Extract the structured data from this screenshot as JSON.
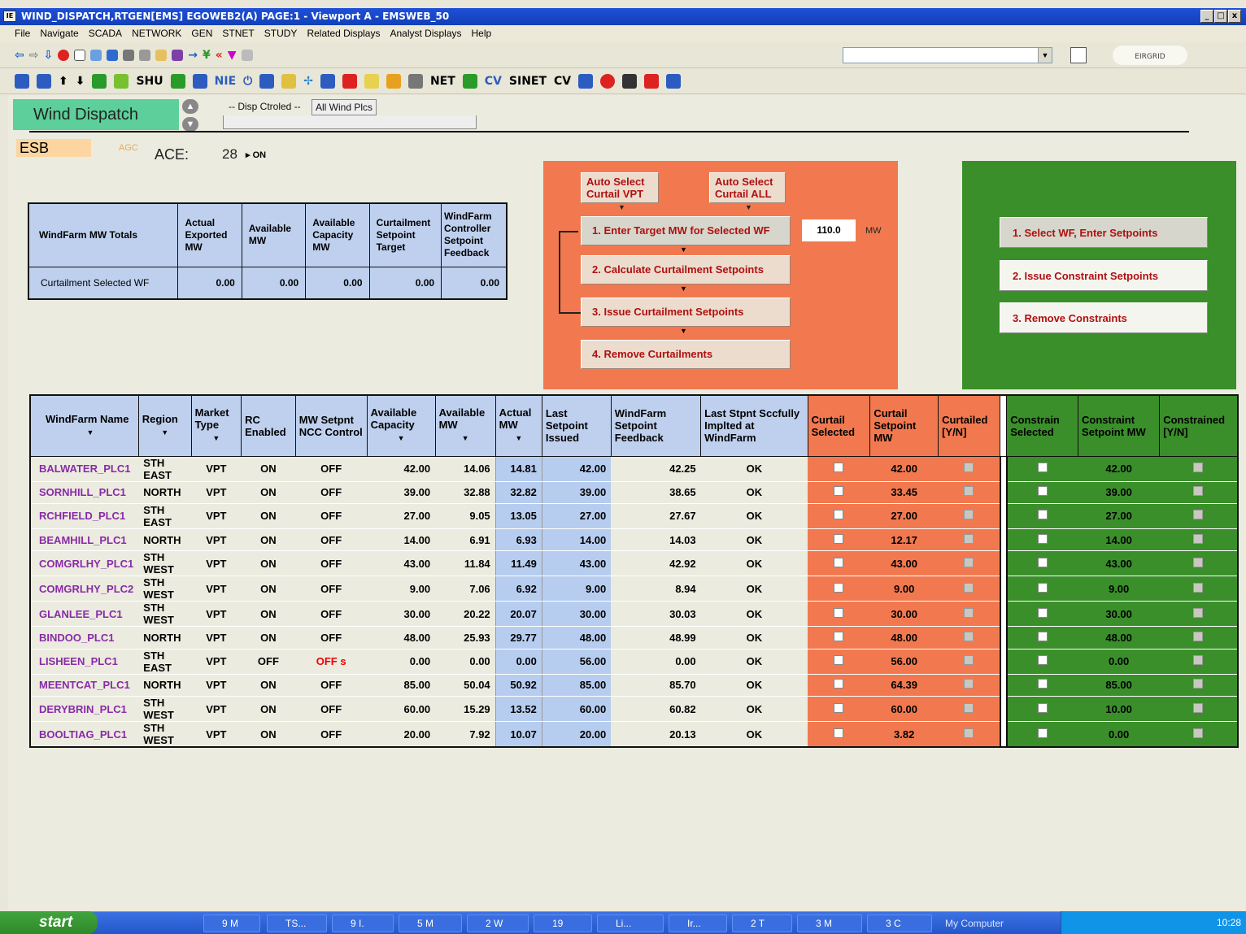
{
  "window": {
    "title": "WIND_DISPATCH,RTGEN[EMS] EGOWEB2(A) PAGE:1  - Viewport A - EMSWEB_50",
    "controls": [
      "_",
      "□",
      "x"
    ]
  },
  "menu": [
    "File",
    "Navigate",
    "SCADA",
    "NETWORK",
    "GEN",
    "STNET",
    "STUDY",
    "Related Displays",
    "Analyst Displays",
    "Help"
  ],
  "toolbar": {
    "labels": [
      "SHU",
      "NIE",
      "NET",
      "CV",
      "SINET",
      "CV"
    ],
    "address": "",
    "logo": "EIRGRID"
  },
  "header": {
    "display_title": "Wind Dispatch",
    "tab_disp": "-- Disp Ctroled --",
    "tab_all": "All Wind Plcs",
    "company": "ESB",
    "agc": "AGC",
    "ace_label": "ACE:",
    "ace_value": "28",
    "ace_status": "ON"
  },
  "totals": {
    "title": "WindFarm MW Totals",
    "columns": [
      "Actual Exported MW",
      "Available MW",
      "Available Capacity MW",
      "Curtailment Setpoint Target",
      "WindFarm Controller Setpoint Feedback"
    ],
    "row_label": "Curtailment Selected WF",
    "values": [
      "0.00",
      "0.00",
      "0.00",
      "0.00",
      "0.00"
    ]
  },
  "curtail_panel": {
    "auto_vpt": "Auto Select Curtail VPT",
    "auto_all": "Auto Select Curtail ALL",
    "step1": "1. Enter Target MW for Selected WF",
    "target_mw": "110.0",
    "unit": "MW",
    "step2": "2. Calculate Curtailment Setpoints",
    "step3": "3. Issue Curtailment Setpoints",
    "step4": "4. Remove Curtailments"
  },
  "constraint_panel": {
    "step1": "1. Select WF, Enter Setpoints",
    "step2": "2. Issue Constraint Setpoints",
    "step3": "3. Remove Constraints"
  },
  "table": {
    "columns": [
      "WindFarm Name",
      "Region",
      "Market Type",
      "RC Enabled",
      "MW Setpnt NCC Control",
      "Available Capacity",
      "Available MW",
      "Actual MW",
      "Last Setpoint Issued",
      "WindFarm Setpoint Feedback",
      "Last Stpnt Sccfully Implted at WindFarm",
      "Curtail Selected",
      "Curtail Setpoint MW",
      "Curtailed [Y/N]",
      "Constrain Selected",
      "Constraint Setpoint MW",
      "Constrained [Y/N]"
    ],
    "rows": [
      {
        "name": "BALWATER_PLC1",
        "region": "STH EAST",
        "market": "VPT",
        "rc": "ON",
        "ncc": "OFF",
        "cap": "42.00",
        "avail": "14.06",
        "actual": "14.81",
        "last": "42.00",
        "fb": "42.25",
        "ok": "OK",
        "curt": "42.00",
        "cons": "42.00"
      },
      {
        "name": "SORNHILL_PLC1",
        "region": "NORTH",
        "market": "VPT",
        "rc": "ON",
        "ncc": "OFF",
        "cap": "39.00",
        "avail": "32.88",
        "actual": "32.82",
        "last": "39.00",
        "fb": "38.65",
        "ok": "OK",
        "curt": "33.45",
        "cons": "39.00"
      },
      {
        "name": "RCHFIELD_PLC1",
        "region": "STH EAST",
        "market": "VPT",
        "rc": "ON",
        "ncc": "OFF",
        "cap": "27.00",
        "avail": "9.05",
        "actual": "13.05",
        "last": "27.00",
        "fb": "27.67",
        "ok": "OK",
        "curt": "27.00",
        "cons": "27.00"
      },
      {
        "name": "BEAMHILL_PLC1",
        "region": "NORTH",
        "market": "VPT",
        "rc": "ON",
        "ncc": "OFF",
        "cap": "14.00",
        "avail": "6.91",
        "actual": "6.93",
        "last": "14.00",
        "fb": "14.03",
        "ok": "OK",
        "curt": "12.17",
        "cons": "14.00"
      },
      {
        "name": "COMGRLHY_PLC1",
        "region": "STH WEST",
        "market": "VPT",
        "rc": "ON",
        "ncc": "OFF",
        "cap": "43.00",
        "avail": "11.84",
        "actual": "11.49",
        "last": "43.00",
        "fb": "42.92",
        "ok": "OK",
        "curt": "43.00",
        "cons": "43.00"
      },
      {
        "name": "COMGRLHY_PLC2",
        "region": "STH WEST",
        "market": "VPT",
        "rc": "ON",
        "ncc": "OFF",
        "cap": "9.00",
        "avail": "7.06",
        "actual": "6.92",
        "last": "9.00",
        "fb": "8.94",
        "ok": "OK",
        "curt": "9.00",
        "cons": "9.00"
      },
      {
        "name": "GLANLEE_PLC1",
        "region": "STH WEST",
        "market": "VPT",
        "rc": "ON",
        "ncc": "OFF",
        "cap": "30.00",
        "avail": "20.22",
        "actual": "20.07",
        "last": "30.00",
        "fb": "30.03",
        "ok": "OK",
        "curt": "30.00",
        "cons": "30.00"
      },
      {
        "name": "BINDOO_PLC1",
        "region": "NORTH",
        "market": "VPT",
        "rc": "ON",
        "ncc": "OFF",
        "cap": "48.00",
        "avail": "25.93",
        "actual": "29.77",
        "last": "48.00",
        "fb": "48.99",
        "ok": "OK",
        "curt": "48.00",
        "cons": "48.00"
      },
      {
        "name": "LISHEEN_PLC1",
        "region": "STH EAST",
        "market": "VPT",
        "rc": "OFF",
        "ncc": "OFF s",
        "cap": "0.00",
        "avail": "0.00",
        "actual": "0.00",
        "last": "56.00",
        "fb": "0.00",
        "ok": "OK",
        "curt": "56.00",
        "cons": "0.00"
      },
      {
        "name": "MEENTCAT_PLC1",
        "region": "NORTH",
        "market": "VPT",
        "rc": "ON",
        "ncc": "OFF",
        "cap": "85.00",
        "avail": "50.04",
        "actual": "50.92",
        "last": "85.00",
        "fb": "85.70",
        "ok": "OK",
        "curt": "64.39",
        "cons": "85.00"
      },
      {
        "name": "DERYBRIN_PLC1",
        "region": "STH WEST",
        "market": "VPT",
        "rc": "ON",
        "ncc": "OFF",
        "cap": "60.00",
        "avail": "15.29",
        "actual": "13.52",
        "last": "60.00",
        "fb": "60.82",
        "ok": "OK",
        "curt": "60.00",
        "cons": "10.00"
      },
      {
        "name": "BOOLTIAG_PLC1",
        "region": "STH WEST",
        "market": "VPT",
        "rc": "ON",
        "ncc": "OFF",
        "cap": "20.00",
        "avail": "7.92",
        "actual": "10.07",
        "last": "20.00",
        "fb": "20.13",
        "ok": "OK",
        "curt": "3.82",
        "cons": "0.00"
      }
    ]
  },
  "taskbar": {
    "start": "start",
    "tasks": [
      "9 M",
      "TS...",
      "9 I.",
      "5 M",
      "2 W",
      "19",
      "Li...",
      "Ir...",
      "2 T",
      "3 M",
      "3 C"
    ],
    "my_computer": "My Computer",
    "clock": "10:28"
  },
  "colors": {
    "orange_panel": "#f2794f",
    "green_panel": "#3a8f2a",
    "header_blue": "#bed0ee",
    "title_green": "#5ccf9a"
  }
}
